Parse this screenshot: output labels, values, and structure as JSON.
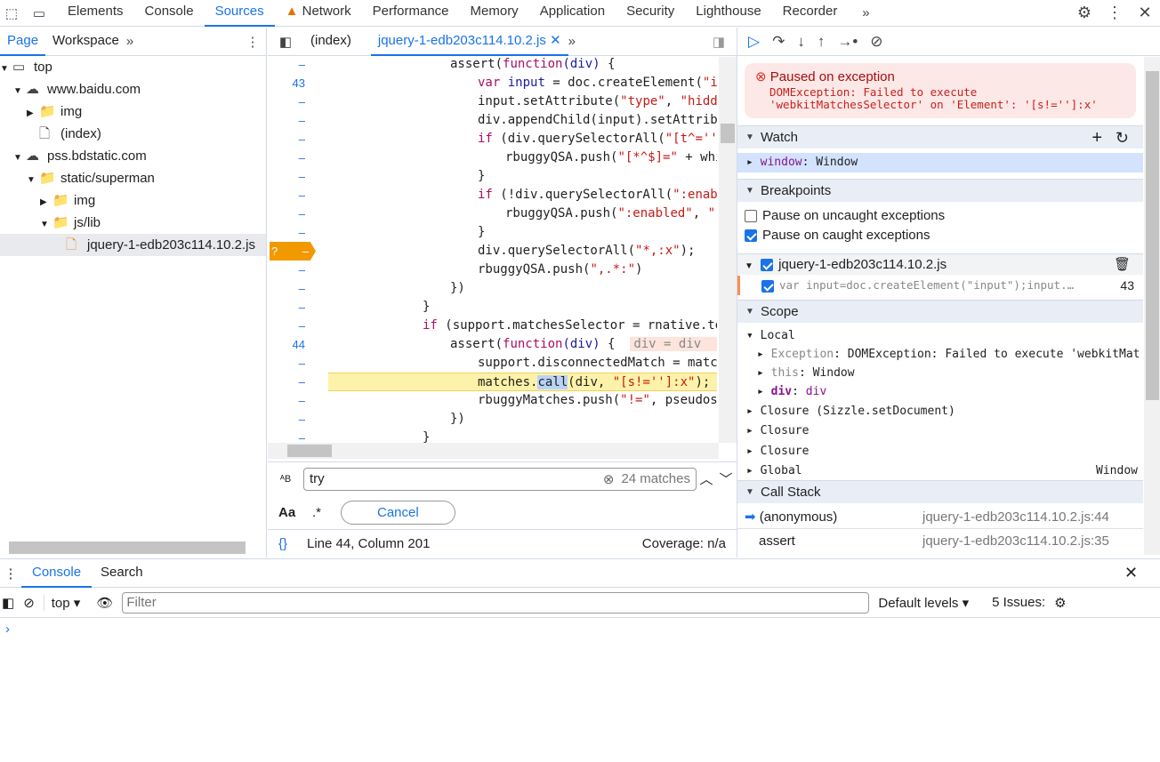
{
  "topbar": {
    "tabs": [
      "Elements",
      "Console",
      "Sources",
      "Network",
      "Performance",
      "Memory",
      "Application",
      "Security",
      "Lighthouse",
      "Recorder"
    ],
    "active": "Sources",
    "network_warning_color": "#e37400"
  },
  "navigator": {
    "tabs": [
      "Page",
      "Workspace"
    ],
    "tree": [
      {
        "label": "top",
        "icon": "frame-icon",
        "depth": 0,
        "expanded": true
      },
      {
        "label": "www.baidu.com",
        "icon": "cloud-icon",
        "depth": 1,
        "expanded": true
      },
      {
        "label": "img",
        "icon": "folder-icon",
        "depth": 2,
        "expanded": false
      },
      {
        "label": "(index)",
        "icon": "file-icon",
        "depth": 2
      },
      {
        "label": "pss.bdstatic.com",
        "icon": "cloud-icon",
        "depth": 1,
        "expanded": true
      },
      {
        "label": "static/superman",
        "icon": "folder-icon",
        "depth": 2,
        "expanded": true
      },
      {
        "label": "img",
        "icon": "folder-icon",
        "depth": 3,
        "expanded": false
      },
      {
        "label": "js/lib",
        "icon": "folder-icon",
        "depth": 3,
        "expanded": true
      },
      {
        "label": "jquery-1-edb203c114.10.2.js",
        "icon": "js-file-icon",
        "depth": 4,
        "selected": true
      }
    ]
  },
  "editor": {
    "tabs": [
      "(index)",
      "jquery-1-edb203c114.10.2.js"
    ],
    "active_tab": "jquery-1-edb203c114.10.2.js",
    "lines": [
      {
        "n": "–",
        "indent": 4,
        "code": [
          [
            "assert(",
            ""
          ],
          [
            "function",
            "kw"
          ],
          [
            "(div)",
            "var"
          ],
          [
            " {",
            ""
          ]
        ]
      },
      {
        "n": "43",
        "indent": 5,
        "code": [
          [
            "var",
            "kw"
          ],
          [
            " input",
            "var"
          ],
          [
            " = doc.createElement(",
            ""
          ],
          [
            "\"inp",
            "str"
          ]
        ]
      },
      {
        "n": "–",
        "indent": 5,
        "code": [
          [
            "input.setAttribute(",
            ""
          ],
          [
            "\"type\"",
            "str"
          ],
          [
            ", ",
            ""
          ],
          [
            "\"hidden",
            "str"
          ]
        ]
      },
      {
        "n": "–",
        "indent": 5,
        "code": [
          [
            "div.appendChild(input).setAttribut",
            ""
          ]
        ]
      },
      {
        "n": "–",
        "indent": 5,
        "code": [
          [
            "if",
            "kw"
          ],
          [
            " (div.querySelectorAll(",
            ""
          ],
          [
            "\"[t^='']\"",
            "str"
          ]
        ]
      },
      {
        "n": "–",
        "indent": 6,
        "code": [
          [
            "rbuggyQSA.push(",
            ""
          ],
          [
            "\"[*^$]=\"",
            "str"
          ],
          [
            " + whit",
            ""
          ]
        ]
      },
      {
        "n": "–",
        "indent": 5,
        "code": [
          [
            "}",
            ""
          ]
        ]
      },
      {
        "n": "–",
        "indent": 5,
        "code": [
          [
            "if",
            "kw"
          ],
          [
            " (!div.querySelectorAll(",
            ""
          ],
          [
            "\":enable",
            "str"
          ]
        ]
      },
      {
        "n": "–",
        "indent": 6,
        "code": [
          [
            "rbuggyQSA.push(",
            ""
          ],
          [
            "\":enabled\"",
            "str"
          ],
          [
            ", ",
            ""
          ],
          [
            "\":d",
            "str"
          ]
        ]
      },
      {
        "n": "–",
        "indent": 5,
        "code": [
          [
            "}",
            ""
          ]
        ]
      },
      {
        "n": "–",
        "indent": 5,
        "code": [
          [
            "div.querySelectorAll(",
            ""
          ],
          [
            "\"*,:x\"",
            "str"
          ],
          [
            ");",
            ""
          ]
        ],
        "breakpoint": "?"
      },
      {
        "n": "–",
        "indent": 5,
        "code": [
          [
            "rbuggyQSA.push(",
            ""
          ],
          [
            "\",.*:\"",
            "str"
          ],
          [
            ")",
            ""
          ]
        ]
      },
      {
        "n": "–",
        "indent": 4,
        "code": [
          [
            "})",
            ""
          ]
        ]
      },
      {
        "n": "–",
        "indent": 3,
        "code": [
          [
            "}",
            ""
          ]
        ]
      },
      {
        "n": "–",
        "indent": 3,
        "code": [
          [
            "if",
            "kw"
          ],
          [
            " (support.matchesSelector = rnative.test",
            ""
          ]
        ]
      },
      {
        "n": "44",
        "indent": 4,
        "code": [
          [
            "assert(",
            ""
          ],
          [
            "function",
            "kw"
          ],
          [
            "(div)",
            "var"
          ],
          [
            " {  ",
            ""
          ]
        ],
        "inline_value": "div = div  {al"
      },
      {
        "n": "–",
        "indent": 5,
        "code": [
          [
            "support.disconnectedMatch = matche",
            ""
          ]
        ]
      },
      {
        "n": "–",
        "indent": 5,
        "code": [
          [
            "matches.",
            ""
          ],
          [
            "call",
            "hl"
          ],
          [
            "(div, ",
            ""
          ],
          [
            "\"[s!='']:x\"",
            "str"
          ],
          [
            ");",
            ""
          ]
        ],
        "current": true
      },
      {
        "n": "–",
        "indent": 5,
        "code": [
          [
            "rbuggyMatches.push(",
            ""
          ],
          [
            "\"!=\"",
            "str"
          ],
          [
            ", pseudos)",
            ""
          ]
        ]
      },
      {
        "n": "–",
        "indent": 4,
        "code": [
          [
            "})",
            ""
          ]
        ]
      },
      {
        "n": "–",
        "indent": 3,
        "code": [
          [
            "}",
            ""
          ]
        ]
      }
    ],
    "search": {
      "value": "try",
      "matches": "24 matches",
      "case_label": "Aa",
      "regex_label": ".*",
      "cancel": "Cancel"
    },
    "status": {
      "position": "Line 44, Column 201",
      "coverage": "Coverage: n/a"
    }
  },
  "debugger": {
    "paused": {
      "title": "Paused on exception",
      "message": "DOMException: Failed to execute\n'webkitMatchesSelector' on 'Element': '[s!='']:x'"
    },
    "watch": {
      "title": "Watch",
      "items": [
        {
          "name": "window",
          "value": "Window"
        }
      ]
    },
    "breakpoints": {
      "title": "Breakpoints",
      "uncaught": "Pause on uncaught exceptions",
      "uncaught_checked": false,
      "caught": "Pause on caught exceptions",
      "caught_checked": true,
      "file": "jquery-1-edb203c114.10.2.js",
      "bp_code": "var input=doc.createElement(\"input\");input.…",
      "bp_line": "43"
    },
    "scope": {
      "title": "Scope",
      "local": "Local",
      "exception_key": "Exception",
      "exception_val": "DOMException: Failed to execute 'webkitMat",
      "this_key": "this",
      "this_val": "Window",
      "div_key": "div",
      "div_val": "div",
      "closures": [
        "Closure (Sizzle.setDocument)",
        "Closure",
        "Closure"
      ],
      "global": "Global",
      "global_val": "Window"
    },
    "callstack": {
      "title": "Call Stack",
      "frames": [
        {
          "name": "(anonymous)",
          "loc": "jquery-1-edb203c114.10.2.js:44",
          "current": true
        },
        {
          "name": "assert",
          "loc": "jquery-1-edb203c114.10.2.js:35"
        }
      ]
    }
  },
  "drawer": {
    "tabs": [
      "Console",
      "Search"
    ],
    "context": "top",
    "filter_placeholder": "Filter",
    "levels": "Default levels ▾",
    "issues": "5 Issues:",
    "prompt": "›"
  }
}
